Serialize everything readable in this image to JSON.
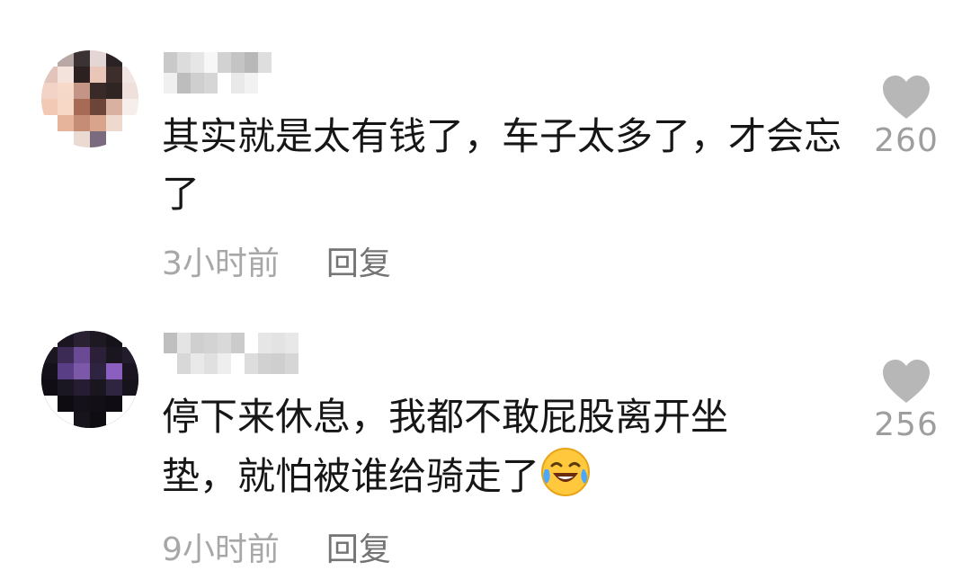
{
  "comments": [
    {
      "username": "",
      "text": "其实就是太有钱了，车子太多了，才会忘了",
      "time": "3小时前",
      "reply_label": "回复",
      "like_count": "260",
      "like_icon": "heart-icon",
      "avatar_colors": [
        "#ffffff",
        "#b9a9a6",
        "#3b3233",
        "#e4d6d5",
        "#2a2224",
        "#ffffff",
        "#e3c4bb",
        "#f4e3dd",
        "#2c2120",
        "#e9c6b8",
        "#3d2e2c",
        "#f2e6e4",
        "#f3d3c5",
        "#f6d9c9",
        "#c49586",
        "#3a2a27",
        "#2f2522",
        "#f0e0dc",
        "#f1c9b4",
        "#f7d8c6",
        "#a66a55",
        "#6d4538",
        "#d9b1a0",
        "#f6eeea",
        "#ffffff",
        "#e6b39b",
        "#c58d75",
        "#d8a58c",
        "#efd8ce",
        "#ffffff",
        "#ffffff",
        "#ffffff",
        "#eadad1",
        "#7a6c7e",
        "#ffffff",
        "#ffffff"
      ]
    },
    {
      "username": "",
      "text": "停下来休息，我都不敢屁股离开坐垫，就怕被谁给骑走了",
      "emoji_icon": "laughing-crying-emoji",
      "time": "9小时前",
      "reply_label": "回复",
      "like_count": "256",
      "like_icon": "heart-icon",
      "avatar_colors": [
        "#ffffff",
        "#1a1520",
        "#2a2233",
        "#1d1822",
        "#15121a",
        "#ffffff",
        "#1b1620",
        "#3c2b55",
        "#6a4a94",
        "#2c2038",
        "#1a1620",
        "#231c2c",
        "#15111a",
        "#5a3e85",
        "#7c58a8",
        "#2e2340",
        "#8a5fc0",
        "#1a1521",
        "#100d14",
        "#1b1722",
        "#261d33",
        "#1a1620",
        "#302541",
        "#17131c",
        "#ffffff",
        "#0e0c11",
        "#14111a",
        "#121016",
        "#0f0d13",
        "#ffffff",
        "#ffffff",
        "#ffffff",
        "#17141c",
        "#0f0d12",
        "#ffffff",
        "#ffffff"
      ]
    }
  ]
}
